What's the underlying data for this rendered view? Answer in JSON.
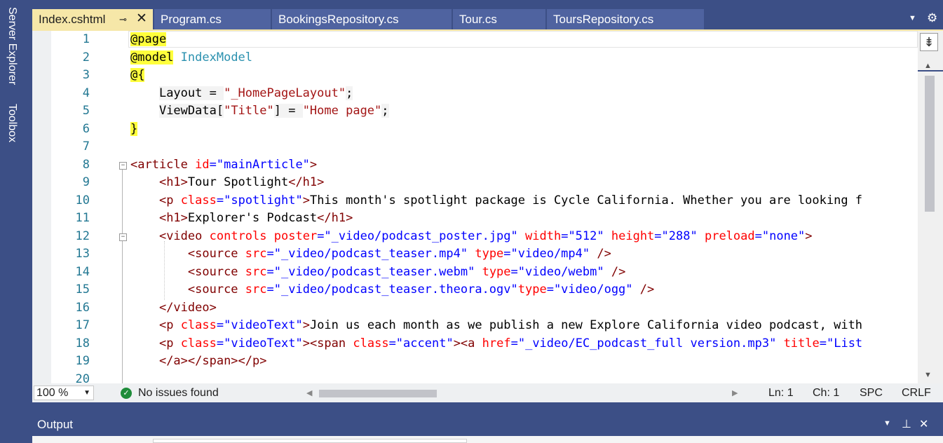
{
  "sidebar": {
    "server_explorer": "Server Explorer",
    "toolbox": "Toolbox"
  },
  "tabs": [
    {
      "label": "Index.cshtml",
      "active": true
    },
    {
      "label": "Program.cs",
      "active": false
    },
    {
      "label": "BookingsRepository.cs",
      "active": false
    },
    {
      "label": "Tour.cs",
      "active": false
    },
    {
      "label": "ToursRepository.cs",
      "active": false
    }
  ],
  "editor": {
    "lines": [
      {
        "n": "1",
        "parts": [
          [
            "hl",
            "@page"
          ]
        ]
      },
      {
        "n": "2",
        "parts": [
          [
            "hl",
            "@model"
          ],
          [
            "txt",
            " "
          ],
          [
            "type",
            "IndexModel"
          ]
        ]
      },
      {
        "n": "3",
        "parts": [
          [
            "hl",
            "@{"
          ]
        ]
      },
      {
        "n": "4",
        "parts": [
          [
            "txt",
            "    "
          ],
          [
            "dir",
            "Layout = "
          ],
          [
            "str",
            "\"_HomePageLayout\""
          ],
          [
            "dir",
            ";"
          ]
        ]
      },
      {
        "n": "5",
        "parts": [
          [
            "txt",
            "    "
          ],
          [
            "dir",
            "ViewData["
          ],
          [
            "str",
            "\"Title\""
          ],
          [
            "dir",
            "] = "
          ],
          [
            "str",
            "\"Home page\""
          ],
          [
            "dir",
            ";"
          ]
        ]
      },
      {
        "n": "6",
        "parts": [
          [
            "hl",
            "}"
          ]
        ]
      },
      {
        "n": "7",
        "parts": []
      },
      {
        "n": "8",
        "parts": [
          [
            "tag",
            "<article"
          ],
          [
            "txt",
            " "
          ],
          [
            "attr",
            "id"
          ],
          [
            "val",
            "=\"mainArticle\""
          ],
          [
            "tag",
            ">"
          ]
        ]
      },
      {
        "n": "9",
        "parts": [
          [
            "txt",
            "    "
          ],
          [
            "tag",
            "<h1>"
          ],
          [
            "txt",
            "Tour Spotlight"
          ],
          [
            "tag",
            "</h1>"
          ]
        ]
      },
      {
        "n": "10",
        "parts": [
          [
            "txt",
            "    "
          ],
          [
            "tag",
            "<p"
          ],
          [
            "txt",
            " "
          ],
          [
            "attr",
            "class"
          ],
          [
            "val",
            "=\"spotlight\""
          ],
          [
            "tag",
            ">"
          ],
          [
            "txt",
            "This month's spotlight package is Cycle California. Whether you are looking f"
          ]
        ]
      },
      {
        "n": "11",
        "parts": [
          [
            "txt",
            "    "
          ],
          [
            "tag",
            "<h1>"
          ],
          [
            "txt",
            "Explorer's Podcast"
          ],
          [
            "tag",
            "</h1>"
          ]
        ]
      },
      {
        "n": "12",
        "parts": [
          [
            "txt",
            "    "
          ],
          [
            "tag",
            "<video"
          ],
          [
            "txt",
            " "
          ],
          [
            "attr",
            "controls"
          ],
          [
            "txt",
            " "
          ],
          [
            "attr",
            "poster"
          ],
          [
            "val",
            "=\"_video/podcast_poster.jpg\""
          ],
          [
            "txt",
            " "
          ],
          [
            "attr",
            "width"
          ],
          [
            "val",
            "=\"512\""
          ],
          [
            "txt",
            " "
          ],
          [
            "attr",
            "height"
          ],
          [
            "val",
            "=\"288\""
          ],
          [
            "txt",
            " "
          ],
          [
            "attr",
            "preload"
          ],
          [
            "val",
            "=\"none\""
          ],
          [
            "tag",
            ">"
          ]
        ]
      },
      {
        "n": "13",
        "parts": [
          [
            "txt",
            "        "
          ],
          [
            "tag",
            "<source"
          ],
          [
            "txt",
            " "
          ],
          [
            "attr",
            "src"
          ],
          [
            "val",
            "=\"_video/podcast_teaser.mp4\""
          ],
          [
            "txt",
            " "
          ],
          [
            "attr",
            "type"
          ],
          [
            "val",
            "=\"video/mp4\""
          ],
          [
            "txt",
            " "
          ],
          [
            "tag",
            "/>"
          ]
        ]
      },
      {
        "n": "14",
        "parts": [
          [
            "txt",
            "        "
          ],
          [
            "tag",
            "<source"
          ],
          [
            "txt",
            " "
          ],
          [
            "attr",
            "src"
          ],
          [
            "val",
            "=\"_video/podcast_teaser.webm\""
          ],
          [
            "txt",
            " "
          ],
          [
            "attr",
            "type"
          ],
          [
            "val",
            "=\"video/webm\""
          ],
          [
            "txt",
            " "
          ],
          [
            "tag",
            "/>"
          ]
        ]
      },
      {
        "n": "15",
        "parts": [
          [
            "txt",
            "        "
          ],
          [
            "tag",
            "<source"
          ],
          [
            "txt",
            " "
          ],
          [
            "attr",
            "src"
          ],
          [
            "val",
            "=\"_video/podcast_teaser.theora.ogv\""
          ],
          [
            "attr",
            "type"
          ],
          [
            "val",
            "=\"video/ogg\""
          ],
          [
            "txt",
            " "
          ],
          [
            "tag",
            "/>"
          ]
        ]
      },
      {
        "n": "16",
        "parts": [
          [
            "txt",
            "    "
          ],
          [
            "tag",
            "</video>"
          ]
        ]
      },
      {
        "n": "17",
        "parts": [
          [
            "txt",
            "    "
          ],
          [
            "tag",
            "<p"
          ],
          [
            "txt",
            " "
          ],
          [
            "attr",
            "class"
          ],
          [
            "val",
            "=\"videoText\""
          ],
          [
            "tag",
            ">"
          ],
          [
            "txt",
            "Join us each month as we publish a new Explore California video podcast, with"
          ]
        ]
      },
      {
        "n": "18",
        "parts": [
          [
            "txt",
            "    "
          ],
          [
            "tag",
            "<p"
          ],
          [
            "txt",
            " "
          ],
          [
            "attr",
            "class"
          ],
          [
            "val",
            "=\"videoText\""
          ],
          [
            "tag",
            "><span"
          ],
          [
            "txt",
            " "
          ],
          [
            "attr",
            "class"
          ],
          [
            "val",
            "=\"accent\""
          ],
          [
            "tag",
            "><a"
          ],
          [
            "txt",
            " "
          ],
          [
            "attr",
            "href"
          ],
          [
            "val",
            "=\"_video/EC_podcast_full version.mp3\""
          ],
          [
            "txt",
            " "
          ],
          [
            "attr",
            "title"
          ],
          [
            "val",
            "=\"List"
          ]
        ]
      },
      {
        "n": "19",
        "parts": [
          [
            "txt",
            "    "
          ],
          [
            "tag",
            "</a></span></p>"
          ]
        ]
      },
      {
        "n": "20",
        "parts": []
      }
    ]
  },
  "status": {
    "zoom": "100 %",
    "issues": "No issues found",
    "line": "Ln: 1",
    "col": "Ch: 1",
    "spc": "SPC",
    "eol": "CRLF"
  },
  "output": {
    "title": "Output"
  },
  "icons": {
    "pin": "pin-icon",
    "close": "close-icon",
    "dropdown": "chevron-down-icon",
    "settings": "gear-icon",
    "check": "check-circle-icon"
  }
}
